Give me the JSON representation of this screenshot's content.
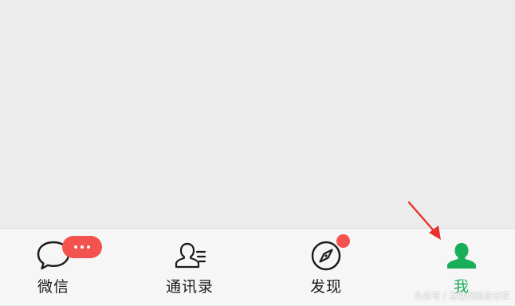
{
  "tabs": [
    {
      "label": "微信",
      "icon": "chat-bubble-icon",
      "active": false
    },
    {
      "label": "通讯录",
      "icon": "contacts-icon",
      "active": false
    },
    {
      "label": "发现",
      "icon": "compass-icon",
      "active": false
    },
    {
      "label": "我",
      "icon": "person-icon",
      "active": true
    }
  ],
  "badges": {
    "chats": "unread-dots",
    "discover": "red-dot"
  },
  "colors": {
    "active": "#1aad5a",
    "inactive": "#1a1a1a",
    "badge": "#f3524f",
    "tab_bar_bg": "#f6f6f6",
    "content_bg": "#ececec"
  },
  "watermark": "头条号 / 互联网信息分享"
}
